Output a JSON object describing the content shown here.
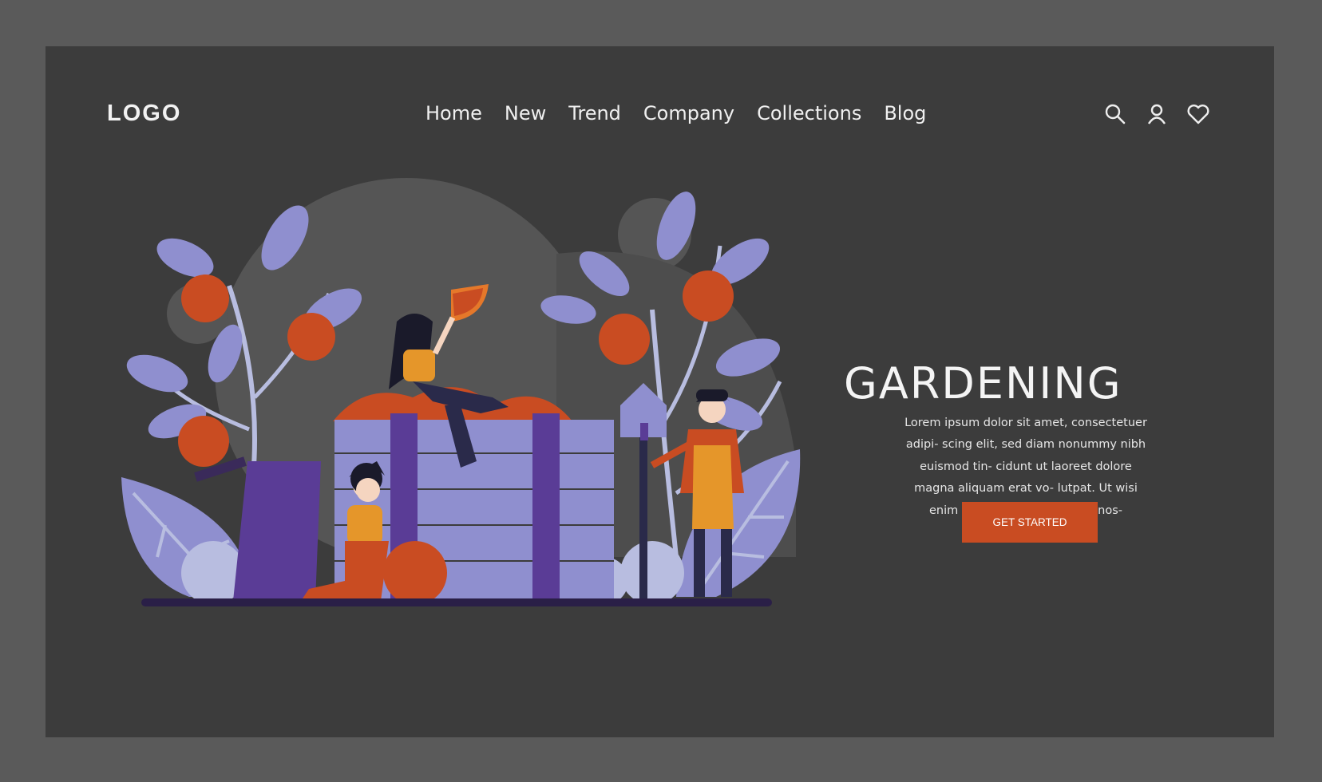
{
  "header": {
    "logo": "LOGO",
    "nav": [
      "Home",
      "New",
      "Trend",
      "Company",
      "Collections",
      "Blog"
    ],
    "icons": [
      "search-icon",
      "user-icon",
      "heart-icon"
    ]
  },
  "hero": {
    "title": "GARDENING",
    "body": "Lorem ipsum dolor sit amet, consectetuer adipi- scing elit, sed diam nonummy nibh euismod tin- cidunt ut laoreet dolore magna aliquam erat vo- lutpat. Ut wisi enim ad minim veniam, quis nos-",
    "cta_label": "GET STARTED"
  },
  "colors": {
    "page_bg": "#5a5a5a",
    "frame_bg": "#3c3c3c",
    "accent": "#c94c22",
    "lavender": "#8f8fcf",
    "purple": "#5a3c96",
    "orange": "#e5782a"
  }
}
